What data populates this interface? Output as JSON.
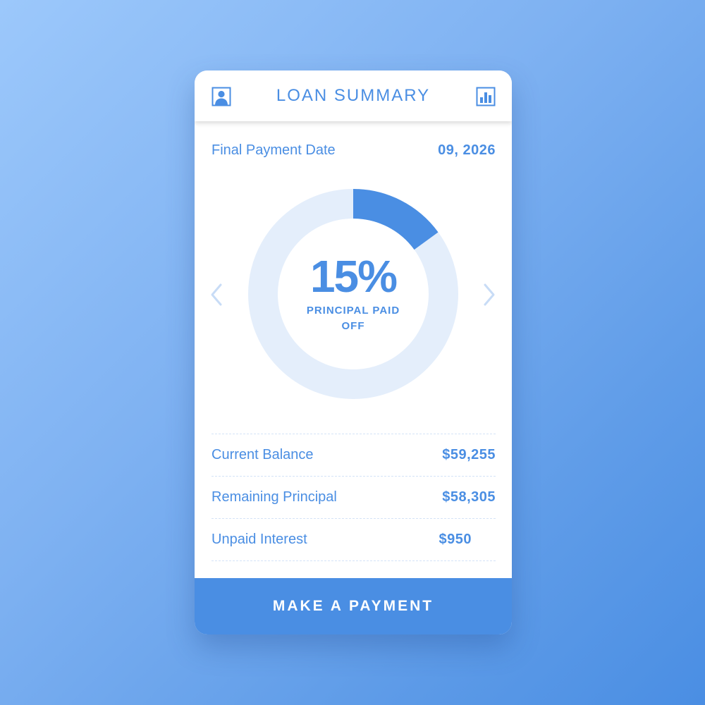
{
  "header": {
    "title": "LOAN SUMMARY",
    "left_icon": "user-profile-icon",
    "right_icon": "bar-chart-icon"
  },
  "final_payment": {
    "label": "Final Payment Date",
    "value": "09, 2026"
  },
  "progress": {
    "percent_text": "15%",
    "fraction": 0.15,
    "label": "PRINCIPAL PAID OFF",
    "prev_icon": "chevron-left-icon",
    "next_icon": "chevron-right-icon"
  },
  "details": [
    {
      "label": "Current Balance",
      "value": "$59,255"
    },
    {
      "label": "Remaining Principal",
      "value": "$58,305"
    },
    {
      "label": "Unpaid Interest",
      "value": "$950"
    }
  ],
  "action": {
    "label": "MAKE A PAYMENT"
  },
  "colors": {
    "accent": "#4a8ee3",
    "ring_track": "#e4eefb",
    "chevron": "#c8dcf6",
    "background_start": "#9cc8fb",
    "background_end": "#4a8ee3"
  }
}
